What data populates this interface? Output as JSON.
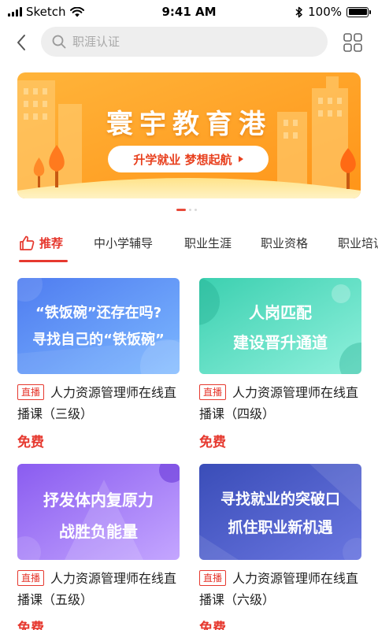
{
  "status_bar": {
    "carrier": "Sketch",
    "time": "9:41 AM",
    "battery": "100%",
    "battery_level": 1.0
  },
  "header": {
    "search_placeholder": "职涯认证"
  },
  "banner": {
    "title": "寰宇教育港",
    "subtitle": "升学就业 梦想起航",
    "page_count": 3,
    "active_page": 1
  },
  "tabs": [
    {
      "label": "推荐",
      "active": true
    },
    {
      "label": "中小学辅导"
    },
    {
      "label": "职业生涯"
    },
    {
      "label": "职业资格"
    },
    {
      "label": "职业培训"
    }
  ],
  "courses": [
    {
      "thumb_lines": [
        "“铁饭碗”还存在吗?",
        "寻找自己的“铁饭碗”"
      ],
      "badge": "直播",
      "title": "人力资源管理师在线直播课（三级）",
      "price": "免费"
    },
    {
      "thumb_lines": [
        "人岗匹配",
        "建设晋升通道"
      ],
      "badge": "直播",
      "title": "人力资源管理师在线直播课（四级）",
      "price": "免费"
    },
    {
      "thumb_lines": [
        "抒发体内复原力",
        "战胜负能量"
      ],
      "badge": "直播",
      "title": "人力资源管理师在线直播课（五级）",
      "price": "免费"
    },
    {
      "thumb_lines": [
        "寻找就业的突破口",
        "抓住职业新机遇"
      ],
      "badge": "直播",
      "title": "人力资源管理师在线直播课（六级）",
      "price": "免费"
    }
  ],
  "icons": {
    "back": "chevron-left-icon",
    "search": "search-icon",
    "grid": "grid-icon",
    "like": "thumbs-up-icon",
    "wifi": "wifi-icon",
    "bluetooth": "bluetooth-icon"
  },
  "colors": {
    "accent": "#e6392f",
    "banner": "#ffa21c"
  }
}
